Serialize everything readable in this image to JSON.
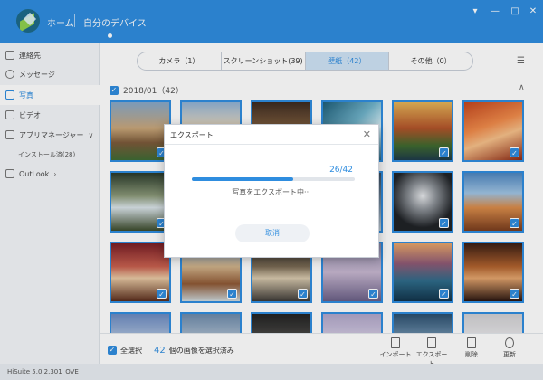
{
  "titlebar": {
    "home_label": "ホーム",
    "device_label": "自分のデバイス",
    "buttons": {
      "menu": "▾",
      "minimize": "—",
      "maximize": "□",
      "close": "✕"
    }
  },
  "sidebar": {
    "items": [
      {
        "label": "連絡先",
        "icon": "contacts-icon"
      },
      {
        "label": "メッセージ",
        "icon": "message-icon"
      },
      {
        "label": "写真",
        "icon": "photo-icon",
        "active": true
      },
      {
        "label": "ビデオ",
        "icon": "video-icon"
      },
      {
        "label": "アプリマネージャー",
        "icon": "apps-icon"
      },
      {
        "label": "OutLook",
        "icon": "mail-icon"
      }
    ],
    "sub_installed": "インストール済(28)",
    "chev_down": "∨",
    "chev_right": "›"
  },
  "tabs": [
    {
      "label": "カメラ（1）"
    },
    {
      "label": "スクリーンショット(39)"
    },
    {
      "label": "壁紙（42）",
      "active": true
    },
    {
      "label": "その他（0）"
    }
  ],
  "group": {
    "title": "2018/01（42）",
    "collapse": "∧"
  },
  "bottombar": {
    "select_all": "全選択",
    "selected_count": "42",
    "selected_suffix": "個の画像を選択済み",
    "actions": {
      "import": "インポート",
      "export": "エクスポート",
      "delete": "削除",
      "refresh": "更新"
    }
  },
  "dialog": {
    "title": "エクスポート",
    "close": "✕",
    "count_text": "26/42",
    "progress": 0.62,
    "message": "写真をエクスポート中···",
    "cancel_label": "取消"
  },
  "status": {
    "version": "HiSuite 5.0.2.301_OVE"
  },
  "colors": {
    "accent": "#2f8ddf"
  },
  "thumbs": [
    {
      "bg": "linear-gradient(180deg,#87a8c9 0%,#c9a77a 45%,#7b5a3a 70%,#3f6b35 100%)"
    },
    {
      "bg": "linear-gradient(180deg,#8fb1d4 0%,#e3d6c0 40%,#c06b3e 70%,#4b5d66 100%)"
    },
    {
      "bg": "linear-gradient(180deg,#3c2a20 0%,#7a5a3c 40%,#e7d8b8 60%,#2a2420 100%)"
    },
    {
      "bg": "linear-gradient(135deg,#1f5f7a 0%,#6fb2c9 45%,#d6eef5 70%,#2c6c8a 100%)"
    },
    {
      "bg": "linear-gradient(180deg,#e5b458 0%,#b2532a 45%,#3f6a2f 75%,#1e3a4a 100%)"
    },
    {
      "bg": "linear-gradient(160deg,#c3461e 0%,#ef8a4a 40%,#f6c08a 60%,#8e2a14 100%)"
    },
    {
      "bg": "linear-gradient(180deg,#2a3a2a 0%,#8c9a7a 40%,#d9e3e8 60%,#3c4b2c 100%)"
    },
    {
      "bg": "linear-gradient(180deg,#6d7f93 0%,#b8c4cf 50%,#7a6b5a 100%)"
    },
    {
      "bg": "linear-gradient(180deg,#2e2b28 0%,#676056 60%,#a69886 100%)"
    },
    {
      "bg": "linear-gradient(180deg,#3a4f63 0%,#8097ab 60%,#c3cfd8 100%)"
    },
    {
      "bg": "radial-gradient(circle at 50% 40%,#e7e9ec 0%,#8c9197 30%,#202327 70%)"
    },
    {
      "bg": "linear-gradient(180deg,#4d86c0 0%,#a0c4e3 35%,#d98b4a 60%,#7a3d1e 100%)"
    },
    {
      "bg": "linear-gradient(180deg,#7a1f26 0%,#c7604f 40%,#e8c9a4 60%,#5a2d1c 100%)"
    },
    {
      "bg": "linear-gradient(180deg,#7ea8d4 0%,#d2b48c 40%,#8f5a36 70%,#cdd8dd 100%)"
    },
    {
      "bg": "linear-gradient(180deg,#2b2b2b 0%,#7a6a54 40%,#d8c9ae 60%,#3d3a36 100%)"
    },
    {
      "bg": "linear-gradient(180deg,#8d89a8 0%,#c7b7d0 50%,#6a5f86 100%)"
    },
    {
      "bg": "linear-gradient(180deg,#e7a56a 0%,#8e5a75 35%,#2f6c8a 65%,#12334a 100%)"
    },
    {
      "bg": "linear-gradient(180deg,#3a1e14 0%,#b0622e 40%,#e3a46d 60%,#2a1610 100%)"
    },
    {
      "bg": "linear-gradient(180deg,#6b8ac0 0%,#c9d7e8 60%)"
    },
    {
      "bg": "linear-gradient(180deg,#6d8aaa 0%,#c7d3df 60%)"
    },
    {
      "bg": "linear-gradient(180deg,#222 0%,#5c5a56 60%)"
    },
    {
      "bg": "linear-gradient(180deg,#b0a6c9 0%,#e0d8ea 60%)"
    },
    {
      "bg": "linear-gradient(180deg,#2b4f6e 0%,#8fb0cc 60%)"
    },
    {
      "bg": "linear-gradient(180deg,#d0cfd2 0%,#f1f1f3 60%)"
    }
  ]
}
